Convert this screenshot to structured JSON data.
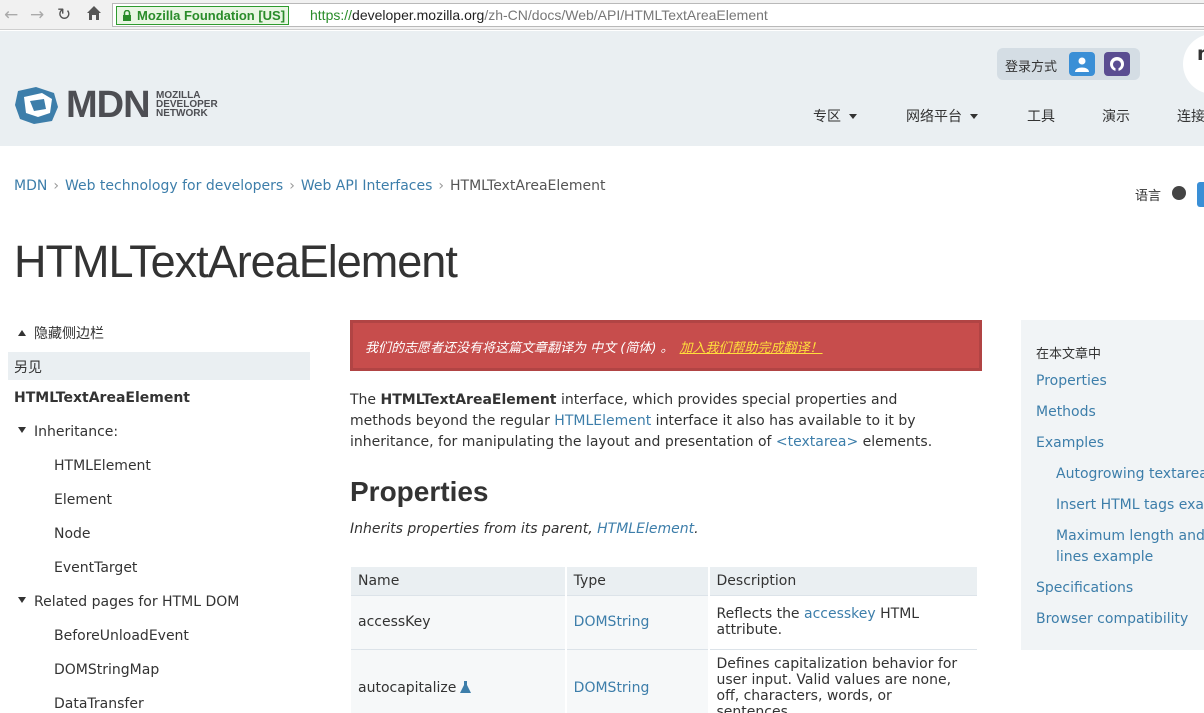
{
  "browser": {
    "ev_org": "Mozilla Foundation [US]",
    "url_scheme": "https://",
    "url_host": "developer.mozilla.org",
    "url_path": "/zh-CN/docs/Web/API/HTMLTextAreaElement"
  },
  "header": {
    "login_label": "登录方式",
    "logo_text": "MDN",
    "logo_sub": [
      "MOZILLA",
      "DEVELOPER",
      "NETWORK"
    ],
    "corner_text": "m",
    "nav": [
      {
        "label": "专区",
        "has_caret": true
      },
      {
        "label": "网络平台",
        "has_caret": true
      },
      {
        "label": "工具",
        "has_caret": false
      },
      {
        "label": "演示",
        "has_caret": false
      },
      {
        "label": "连接",
        "has_caret": false
      }
    ]
  },
  "breadcrumbs": [
    {
      "label": "MDN"
    },
    {
      "label": "Web technology for developers"
    },
    {
      "label": "Web API Interfaces"
    }
  ],
  "breadcrumb_current": "HTMLTextAreaElement",
  "language_label": "语言",
  "page_title": "HTMLTextAreaElement",
  "sidebar": {
    "toggle_label": "隐藏侧边栏",
    "see_also": "另见",
    "interface": "HTMLTextAreaElement",
    "inheritance_label": "Inheritance:",
    "inheritance": [
      "HTMLElement",
      "Element",
      "Node",
      "EventTarget"
    ],
    "related_label": "Related pages for HTML DOM",
    "related": [
      "BeforeUnloadEvent",
      "DOMStringMap",
      "DataTransfer"
    ]
  },
  "notice": {
    "text": "我们的志愿者还没有将这篇文章翻译为 中文 (简体) 。",
    "cta": "加入我们帮助完成翻译！"
  },
  "intro": {
    "p1": "The ",
    "interface_name": "HTMLTextAreaElement",
    "p2": " interface, which provides special properties and methods beyond the regular ",
    "link1": "HTMLElement",
    "p3": " interface it also has available to it by inheritance, for manipulating the layout and presentation of ",
    "link2": "<textarea>",
    "p4": " elements."
  },
  "properties": {
    "heading": "Properties",
    "inherits_text": "Inherits properties from its parent, ",
    "inherits_link": "HTMLElement",
    "inherits_end": ".",
    "columns": [
      "Name",
      "Type",
      "Description"
    ],
    "rows": [
      {
        "name": "accessKey",
        "type": "DOMString",
        "desc_pre": "Reflects the ",
        "desc_link": "accesskey",
        "desc_post": " HTML attribute."
      },
      {
        "name": "autocapitalize",
        "type": "DOMString",
        "desc_pre": "Defines capitalization behavior for user input. Valid values are none, off, characters, words, or sentences.",
        "desc_link": "",
        "desc_post": ""
      }
    ]
  },
  "toc": {
    "title": "在本文章中",
    "items": [
      "Properties",
      "Methods",
      "Examples",
      "Autogrowing textarea",
      "Insert HTML tags example",
      "Maximum length and",
      "lines example",
      "Specifications",
      "Browser compatibility"
    ]
  },
  "colors": {
    "link": "#3d7eaa",
    "header_bg": "#eaeff2",
    "notice_bg": "#c74d4c",
    "notice_cta": "#ffde3b"
  }
}
